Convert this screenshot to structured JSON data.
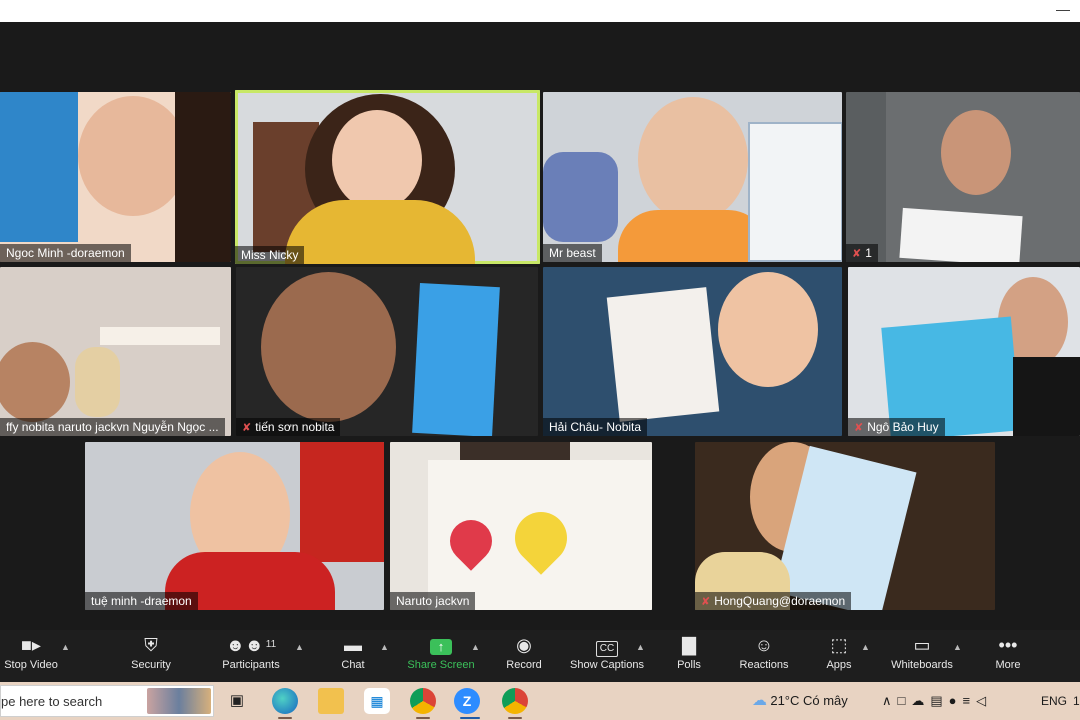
{
  "participants": [
    {
      "name": "Ngoc Minh -doraemon",
      "muted": false,
      "bg": "#f1d9c7",
      "skin": "#e7b89b",
      "hair": "#2a1a12"
    },
    {
      "name": "Miss Nicky",
      "muted": false,
      "bg": "#d7dadd",
      "skin": "#f0c8ae",
      "hair": "#3b2418",
      "shirt": "#e6b733"
    },
    {
      "name": "Mr beast",
      "muted": false,
      "bg": "#cfd3d8",
      "skin": "#e9c0a2",
      "hair": "#1d1d1d",
      "shirt": "#f49a3a"
    },
    {
      "name": "1",
      "muted": true,
      "bg": "#5a5e60",
      "skin": "#c99578",
      "hair": "#151515"
    },
    {
      "name": "ffy nobita naruto jackvn Nguyễn Ngọc ...",
      "muted": false,
      "bg": "#d8cfc8",
      "skin": "#b78363",
      "hair": "#1b1511"
    },
    {
      "name": "tiến sơn nobita",
      "muted": true,
      "bg": "#262626",
      "skin": "#9b6a4e",
      "hair": "#111111"
    },
    {
      "name": "Hải Châu- Nobita",
      "muted": false,
      "bg": "#2e4f6e",
      "skin": "#efc3a3",
      "hair": "#1a1410"
    },
    {
      "name": "Ngô Bảo Huy",
      "muted": true,
      "bg": "#dfe2e6",
      "skin": "#d3a184",
      "hair": "#121212"
    },
    {
      "name": "tuệ minh -draemon",
      "muted": false,
      "bg": "#c9ccd1",
      "skin": "#efc2a2",
      "hair": "#111111",
      "shirt": "#cc2222"
    },
    {
      "name": "Naruto jackvn",
      "muted": false,
      "bg": "#e9e5df",
      "skin": "#e0b08f",
      "hair": "#1a1a1a"
    },
    {
      "name": "HongQuang@doraemon",
      "muted": true,
      "bg": "#3a2a1e",
      "skin": "#d9a47b",
      "hair": "#151515"
    }
  ],
  "toolbar": {
    "stop_video": "Stop Video",
    "security": "Security",
    "participants": "Participants",
    "participants_count": "11",
    "chat": "Chat",
    "share_screen": "Share Screen",
    "record": "Record",
    "show_captions": "Show Captions",
    "polls": "Polls",
    "reactions": "Reactions",
    "apps": "Apps",
    "whiteboards": "Whiteboards",
    "more": "More",
    "share_color": "#3bc05a"
  },
  "taskbar": {
    "search_placeholder": "pe here to search",
    "weather": "21°C  Có mây",
    "language": "ENG",
    "clock_fragment": "1"
  },
  "icons": [
    "camera-icon",
    "shield-icon",
    "people-icon",
    "chat-bubble-icon",
    "share-arrow-icon",
    "record-icon",
    "cc-icon",
    "bar-chart-icon",
    "emoji-plus-icon",
    "apps-icon",
    "whiteboard-icon",
    "dots-icon"
  ]
}
